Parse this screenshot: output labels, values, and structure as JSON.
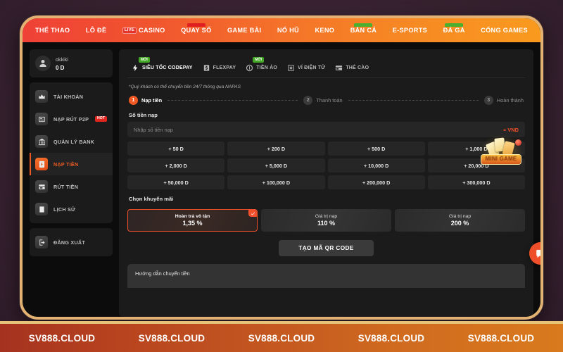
{
  "topnav": {
    "items": [
      {
        "label": "THỂ THAO",
        "tag": "none",
        "badge": ""
      },
      {
        "label": "LÔ ĐỀ",
        "tag": "none",
        "badge": ""
      },
      {
        "label": "CASINO",
        "tag": "none",
        "badge": "LIVE"
      },
      {
        "label": "QUAY SỐ",
        "tag": "red",
        "badge": ""
      },
      {
        "label": "GAME BÀI",
        "tag": "none",
        "badge": ""
      },
      {
        "label": "NỔ HŨ",
        "tag": "none",
        "badge": ""
      },
      {
        "label": "KENO",
        "tag": "none",
        "badge": ""
      },
      {
        "label": "BẮN CÁ",
        "tag": "green",
        "badge": ""
      },
      {
        "label": "E-SPORTS",
        "tag": "none",
        "badge": ""
      },
      {
        "label": "ĐÁ GÀ",
        "tag": "green",
        "badge": ""
      },
      {
        "label": "CỔNG GAMES",
        "tag": "none",
        "badge": ""
      }
    ]
  },
  "sidebar": {
    "profile": {
      "username": "okkiki",
      "balance": "0 D"
    },
    "items": [
      {
        "label": "TÀI KHOẢN",
        "icon": "crown-icon",
        "badge": "",
        "active": false
      },
      {
        "label": "NẠP RÚT P2P",
        "icon": "exchange-icon",
        "badge": "HOT",
        "active": false
      },
      {
        "label": "QUẢN LÝ BANK",
        "icon": "bank-icon",
        "badge": "",
        "active": false
      },
      {
        "label": "NẠP TIỀN",
        "icon": "deposit-icon",
        "badge": "",
        "active": true
      },
      {
        "label": "RÚT TIỀN",
        "icon": "withdraw-icon",
        "badge": "",
        "active": false
      },
      {
        "label": "LỊCH SỬ",
        "icon": "history-icon",
        "badge": "",
        "active": false
      }
    ],
    "logout": {
      "label": "ĐĂNG XUẤT",
      "icon": "logout-icon"
    }
  },
  "main": {
    "pay_tabs": [
      {
        "label": "SIÊU TỐC CODEPAY",
        "icon": "lightning-icon",
        "badge": "MỚI",
        "active": true
      },
      {
        "label": "FLEXPAY",
        "icon": "dollar-icon",
        "badge": "",
        "active": false
      },
      {
        "label": "TIỀN ẢO",
        "icon": "coin-icon",
        "badge": "MỚI",
        "active": false
      },
      {
        "label": "VÍ ĐIỆN TỬ",
        "icon": "wallet-icon",
        "badge": "",
        "active": false
      },
      {
        "label": "THẺ CÀO",
        "icon": "card-icon",
        "badge": "",
        "active": false
      }
    ],
    "notice": "*Quý khách có thể chuyển tiền 24/7 thông qua NAPAS",
    "steps": [
      {
        "num": "1",
        "label": "Nạp tiền",
        "active": true
      },
      {
        "num": "2",
        "label": "Thanh toán",
        "active": false
      },
      {
        "num": "3",
        "label": "Hoàn thành",
        "active": false
      }
    ],
    "amount_label": "Số tiền nạp",
    "amount_placeholder": "Nhập số tiền nạp",
    "amount_value": "",
    "currency": "= VND",
    "quick_amounts": [
      "+ 50 D",
      "+ 200 D",
      "+ 500 D",
      "+ 1,000 D",
      "+ 2,000 D",
      "+ 5,000 D",
      "+ 10,000 D",
      "+ 20,000 D",
      "+ 50,000 D",
      "+ 100,000 D",
      "+ 200,000 D",
      "+ 300,000 D"
    ],
    "promo_label": "Chọn khuyến mãi",
    "promos": [
      {
        "title": "Hoàn trả vô tận",
        "value": "1,35 %",
        "selected": true
      },
      {
        "title": "Giá trị nạp",
        "value": "110 %",
        "selected": false
      },
      {
        "title": "Giá trị nạp",
        "value": "200 %",
        "selected": false
      }
    ],
    "qr_button": "TẠO MÃ QR CODE",
    "guide_title": "Hướng dẫn chuyển tiền"
  },
  "floating": {
    "minigame_label": "MINI GAME",
    "chat_icon": "chat-bubble-icon"
  },
  "footer": {
    "watermarks": [
      "SV888.CLOUD",
      "SV888.CLOUD",
      "SV888.CLOUD",
      "SV888.CLOUD",
      "SV888.CLOUD"
    ]
  },
  "colors": {
    "accent": "#ef5a24",
    "nav_start": "#ef4137",
    "nav_end": "#f99a1e",
    "frame": "#e3b172",
    "badge_green": "#43a825",
    "badge_red": "#e0261f"
  }
}
